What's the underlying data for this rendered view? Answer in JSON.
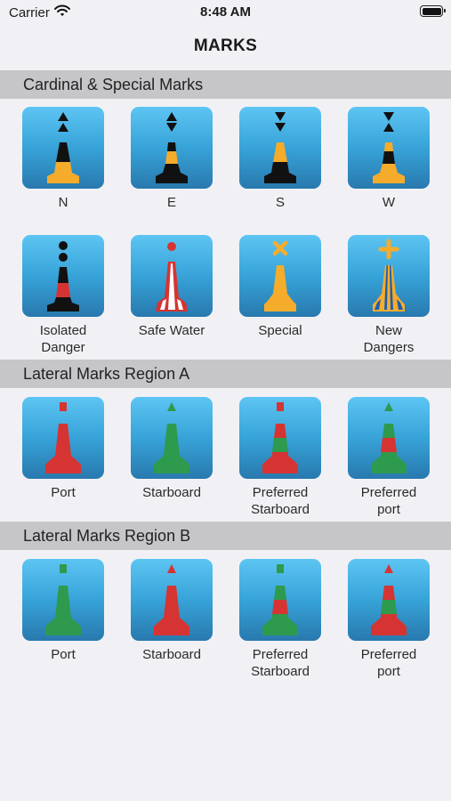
{
  "status_bar": {
    "carrier": "Carrier",
    "time": "8:48 AM"
  },
  "nav": {
    "title": "MARKS"
  },
  "sections": [
    {
      "title": "Cardinal & Special Marks",
      "items": [
        {
          "label": "N",
          "icon": "cardinal-north-buoy-icon"
        },
        {
          "label": "E",
          "icon": "cardinal-east-buoy-icon"
        },
        {
          "label": "S",
          "icon": "cardinal-south-buoy-icon"
        },
        {
          "label": "W",
          "icon": "cardinal-west-buoy-icon"
        },
        {
          "label": "Isolated\nDanger",
          "icon": "isolated-danger-buoy-icon"
        },
        {
          "label": "Safe Water",
          "icon": "safe-water-buoy-icon"
        },
        {
          "label": "Special",
          "icon": "special-mark-buoy-icon"
        },
        {
          "label": "New\nDangers",
          "icon": "new-danger-buoy-icon"
        }
      ]
    },
    {
      "title": "Lateral Marks  Region A",
      "items": [
        {
          "label": "Port",
          "icon": "port-buoy-red-icon"
        },
        {
          "label": "Starboard",
          "icon": "starboard-buoy-green-icon"
        },
        {
          "label": "Preferred\nStarboard",
          "icon": "preferred-starboard-buoy-icon"
        },
        {
          "label": "Preferred\nport",
          "icon": "preferred-port-buoy-icon"
        }
      ]
    },
    {
      "title": "Lateral Marks  Region B",
      "items": [
        {
          "label": "Port",
          "icon": "port-buoy-green-icon"
        },
        {
          "label": "Starboard",
          "icon": "starboard-buoy-red-icon"
        },
        {
          "label": "Preferred\nStarboard",
          "icon": "preferred-starboard-buoy-icon"
        },
        {
          "label": "Preferred\nport",
          "icon": "preferred-port-buoy-icon"
        }
      ]
    }
  ],
  "colors": {
    "red": "#d63432",
    "green": "#2e9a4e",
    "yellow": "#f5ac2b",
    "black": "#111111",
    "blue": "#1c5db0",
    "white": "#ffffff",
    "header_bg": "#c6c6c9",
    "page_bg": "#f1f1f5"
  }
}
